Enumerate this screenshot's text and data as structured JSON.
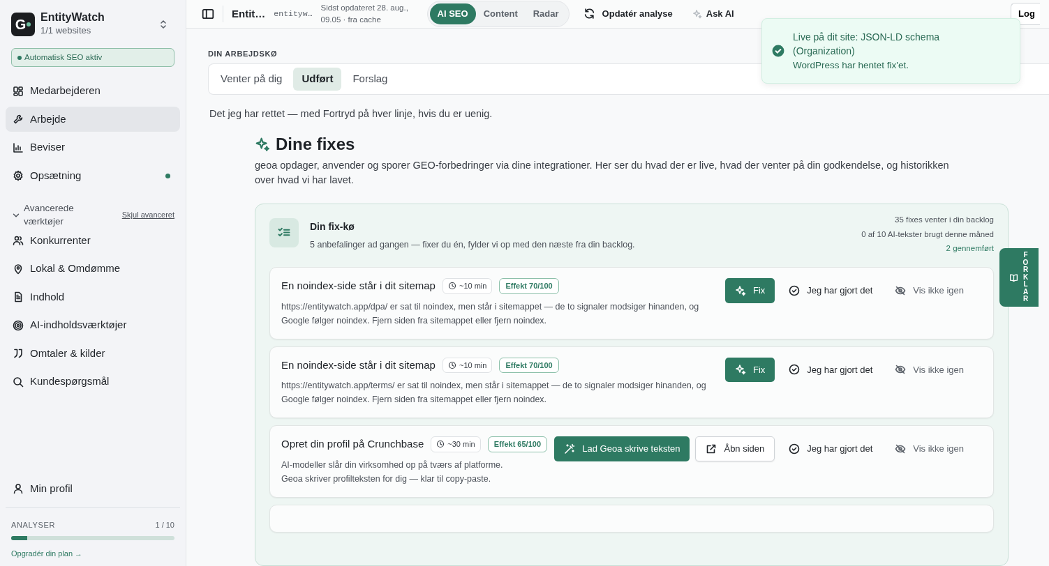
{
  "sidebar": {
    "brand": {
      "logo": "G",
      "name": "EntityWatch",
      "subtitle": "1/1 websites"
    },
    "status_badge": "Automatisk SEO aktiv",
    "nav_items": [
      {
        "label": "Medarbejderen",
        "selected": false,
        "dot": false
      },
      {
        "label": "Arbejde",
        "selected": true,
        "dot": false
      },
      {
        "label": "Beviser",
        "selected": false,
        "dot": false
      },
      {
        "label": "Opsætning",
        "selected": false,
        "dot": true
      }
    ],
    "advanced": {
      "label": "Avancerede værktøjer",
      "toggle": "Skjul avanceret",
      "expanded": true
    },
    "advanced_items": [
      {
        "label": "Konkurrenter",
        "selected": false
      },
      {
        "label": "Lokal & Omdømme",
        "selected": false
      },
      {
        "label": "Indhold",
        "selected": false
      },
      {
        "label": "AI-indholdsværktøjer",
        "selected": false
      },
      {
        "label": "Omtaler & kilder",
        "selected": false
      },
      {
        "label": "Kundespørgsmål",
        "selected": false
      }
    ],
    "profile": "Min profil",
    "usage": {
      "label": "ANALYSER",
      "count": "1 / 10",
      "level": 0.1,
      "link": "Opgradér din plan →"
    }
  },
  "topbar": {
    "title": "Entit…",
    "domain": "entityw…",
    "updated": "Sidst opdateret 28. aug., 09.05 · fra cache",
    "modes": [
      {
        "label": "AI SEO",
        "selected": true
      },
      {
        "label": "Content",
        "selected": false
      },
      {
        "label": "Radar",
        "selected": false
      }
    ],
    "refresh": "Opdatér analyse",
    "ask_ai": "Ask AI",
    "login": "Log"
  },
  "toast": {
    "title": "Live på dit site: JSON-LD schema (Organization)",
    "message": "WordPress har hentet fix'et."
  },
  "worklist": {
    "heading": "DIN ARBEJDSKØ",
    "tabs": [
      {
        "label": "Venter på dig",
        "selected": false
      },
      {
        "label": "Udført",
        "selected": true
      },
      {
        "label": "Forslag",
        "selected": false
      }
    ],
    "intro": "Det jeg har rettet — med Fortryd på hver linje, hvis du er uenig."
  },
  "fixes": {
    "title": "Dine fixes",
    "description": "geoa opdager, anvender og sporer GEO-forbedringer via dine integrationer. Her ser du hvad der er live, hvad der venter på din godkendelse, og historikken over hvad vi har lavet.",
    "queue": {
      "title": "Din fix-kø",
      "subtitle": "5 anbefalinger ad gangen — fixer du én, fylder vi op med den næste fra din backlog.",
      "stats": [
        "35 fixes venter i din backlog",
        "0 af 10 AI-tekster brugt denne måned"
      ],
      "completed": "2 gennemført",
      "items": [
        {
          "title": "En noindex-side står i dit sitemap",
          "time": "~10 min",
          "effect": "Effekt 70/100",
          "description": "https://entitywatch.app/dpa/ er sat til noindex, men står i sitemappet — de to signaler modsiger hinanden, og Google følger noindex. Fjern siden fra sitemappet eller fjern noindex.",
          "actions": [
            {
              "kind": "fix",
              "label": "Fix"
            },
            {
              "kind": "done",
              "label": "Jeg har gjort det"
            },
            {
              "kind": "hide",
              "label": "Vis ikke igen"
            }
          ]
        },
        {
          "title": "En noindex-side står i dit sitemap",
          "time": "~10 min",
          "effect": "Effekt 70/100",
          "description": "https://entitywatch.app/terms/ er sat til noindex, men står i sitemappet — de to signaler modsiger hinanden, og Google følger noindex. Fjern siden fra sitemappet eller fjern noindex.",
          "actions": [
            {
              "kind": "fix",
              "label": "Fix"
            },
            {
              "kind": "done",
              "label": "Jeg har gjort det"
            },
            {
              "kind": "hide",
              "label": "Vis ikke igen"
            }
          ]
        },
        {
          "title": "Opret din profil på Crunchbase",
          "time": "~30 min",
          "effect": "Effekt 65/100",
          "description": "AI-modeller slår din virksomhed op på tværs af platforme.\nGeoa skriver profilteksten for dig — klar til copy-paste.",
          "actions": [
            {
              "kind": "write",
              "label": "Lad Geoa skrive teksten"
            },
            {
              "kind": "open",
              "label": "Åbn siden"
            },
            {
              "kind": "done",
              "label": "Jeg har gjort det"
            },
            {
              "kind": "hide",
              "label": "Vis ikke igen"
            }
          ]
        }
      ]
    },
    "side_tab": "FORKLAR"
  }
}
